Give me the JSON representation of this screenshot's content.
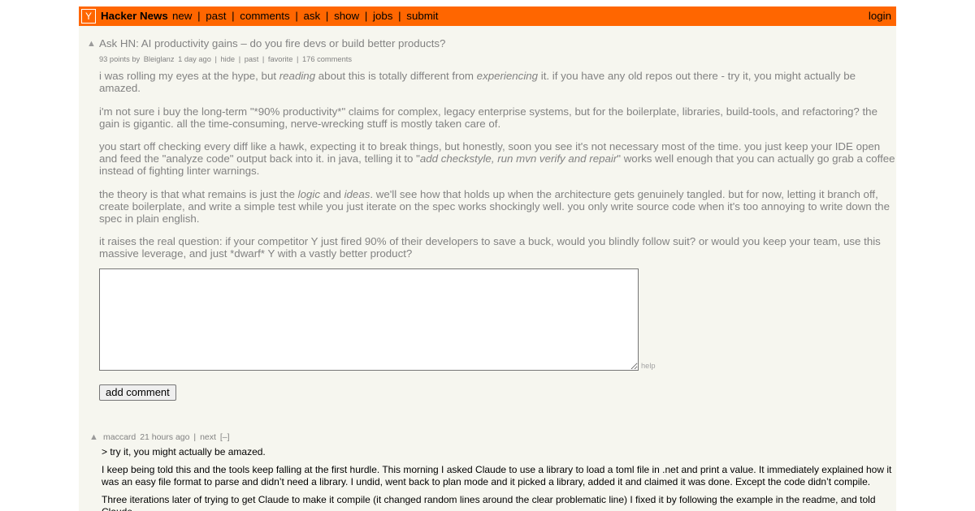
{
  "header": {
    "logo_letter": "Y",
    "brand": "Hacker News",
    "nav": [
      "new",
      "past",
      "comments",
      "ask",
      "show",
      "jobs",
      "submit"
    ],
    "nav_separator": "|",
    "login": "login"
  },
  "story": {
    "vote_arrow": "▲",
    "title": "Ask HN: AI productivity gains – do you fire devs or build better products?",
    "points_by": "93 points by",
    "user": "Bleiglanz",
    "age": "1 day ago",
    "hide": "hide",
    "past": "past",
    "favorite": "favorite",
    "comments": "176 comments",
    "sep": "|",
    "paragraphs": [
      [
        {
          "t": "i was rolling my eyes at the hype, but "
        },
        {
          "t": "reading",
          "i": true
        },
        {
          "t": " about this is totally different from "
        },
        {
          "t": "experiencing",
          "i": true
        },
        {
          "t": " it. if you have any old repos out there - try it, you might actually be amazed."
        }
      ],
      [
        {
          "t": "i'm not sure i buy the long-term \"*90% productivity*\" claims for complex, legacy enterprise systems, but for the boilerplate, libraries, build-tools, and refactoring? the gain is gigantic. all the time-consuming, nerve-wrecking stuff is mostly taken care of."
        }
      ],
      [
        {
          "t": "you start off checking every diff like a hawk, expecting it to break things, but honestly, soon you see it's not necessary most of the time. you just keep your IDE open and feed the \"analyze code\" output back into it. in java, telling it to \""
        },
        {
          "t": "add checkstyle, run mvn verify and repair",
          "i": true
        },
        {
          "t": "\" works well enough that you can actually go grab a coffee instead of fighting linter warnings."
        }
      ],
      [
        {
          "t": "the theory is that what remains is just the "
        },
        {
          "t": "logic",
          "i": true
        },
        {
          "t": " and "
        },
        {
          "t": "ideas",
          "i": true
        },
        {
          "t": ". we'll see how that holds up when the architecture gets genuinely tangled. but for now, letting it branch off, create boilerplate, and write a simple test while you just iterate on the spec works shockingly well. you only write source code when it's too annoying to write down the spec in plain english."
        }
      ],
      [
        {
          "t": "it raises the real question: if your competitor Y just fired 90% of their developers to save a buck, would you blindly follow suit? or would you keep your team, use this massive leverage, and just *dwarf* Y with a vastly better product?"
        }
      ]
    ]
  },
  "reply_form": {
    "help": "help",
    "submit_label": "add comment"
  },
  "comment": {
    "vote_arrow": "▲",
    "user": "maccard",
    "age": "21 hours ago",
    "sep": "|",
    "next": "next",
    "toggle": "[–]",
    "paragraphs": [
      "> try it, you might actually be amazed.",
      "I keep being told this and the tools keep falling at the first hurdle. This morning I asked Claude to use a library to load a toml file in .net and print a value. It immediately explained how it was an easy file format to parse and didn’t need a library. I undid, went back to plan mode and it picked a library, added it and claimed it was done. Except the code didn’t compile.",
      "Three iterations later of trying to get Claude to make it compile (it changed random lines around the clear problematic line) I fixed it by following the example in the readme, and told Claude."
    ]
  }
}
